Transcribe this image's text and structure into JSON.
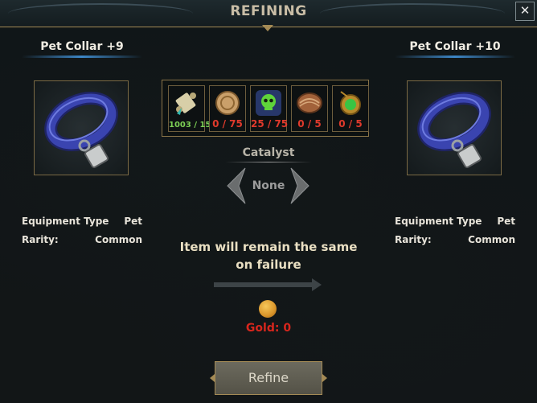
{
  "window": {
    "title": "REFINING",
    "close_label": "✕"
  },
  "left_item": {
    "name": "Pet Collar +9",
    "icon": "pet-collar-icon",
    "stats": [
      {
        "label": "Equipment Type",
        "value": "Pet"
      },
      {
        "label": "Rarity:",
        "value": "Common"
      }
    ]
  },
  "right_item": {
    "name": "Pet Collar +10",
    "icon": "pet-collar-icon",
    "stats": [
      {
        "label": "Equipment Type",
        "value": "Pet"
      },
      {
        "label": "Rarity:",
        "value": "Common"
      }
    ]
  },
  "materials": [
    {
      "icon": "scroll-icon",
      "count": "1003 / 15",
      "sufficient": true
    },
    {
      "icon": "bronze-coin-icon",
      "count": "0 / 75",
      "sufficient": false
    },
    {
      "icon": "skull-badge-icon",
      "count": "25 / 75",
      "sufficient": false
    },
    {
      "icon": "armor-plate-icon",
      "count": "0 / 5",
      "sufficient": false
    },
    {
      "icon": "green-amulet-icon",
      "count": "0 / 5",
      "sufficient": false
    }
  ],
  "catalyst": {
    "label": "Catalyst",
    "value": "None"
  },
  "failure_message": "Item will remain the same on failure",
  "gold": {
    "label": "Gold: 0",
    "icon": "gold-coin-icon"
  },
  "refine_button": {
    "label": "Refine"
  },
  "colors": {
    "sufficient": "#7ccf55",
    "insufficient": "#e03a2c",
    "frame_gold": "#a48a55",
    "accent_blue": "#3d86c6"
  }
}
